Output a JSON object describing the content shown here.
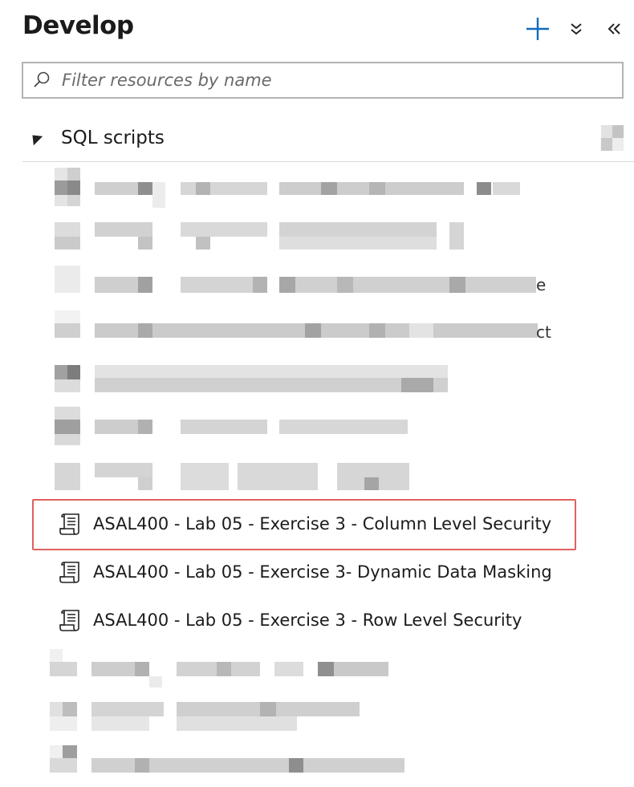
{
  "header": {
    "title": "Develop",
    "add_icon": "plus-icon",
    "expand_icon": "chevron-double-down-icon",
    "collapse_icon": "chevron-double-left-icon"
  },
  "search": {
    "placeholder": "Filter resources by name",
    "value": ""
  },
  "section": {
    "label": "SQL scripts",
    "expanded": true
  },
  "scripts": [
    {
      "name": "ASAL400 - Lab 05 - Exercise 3 - Column Level Security",
      "highlighted": true
    },
    {
      "name": "ASAL400 - Lab 05 - Exercise 3- Dynamic Data Masking"
    },
    {
      "name": "ASAL400 - Lab 05 - Exercise 3 - Row Level Security"
    }
  ],
  "blurred_tails": [
    "e",
    "ct"
  ],
  "colors": {
    "accent": "#0f6cbd",
    "highlight_border": "#e06060",
    "text": "#1b1b1b"
  }
}
